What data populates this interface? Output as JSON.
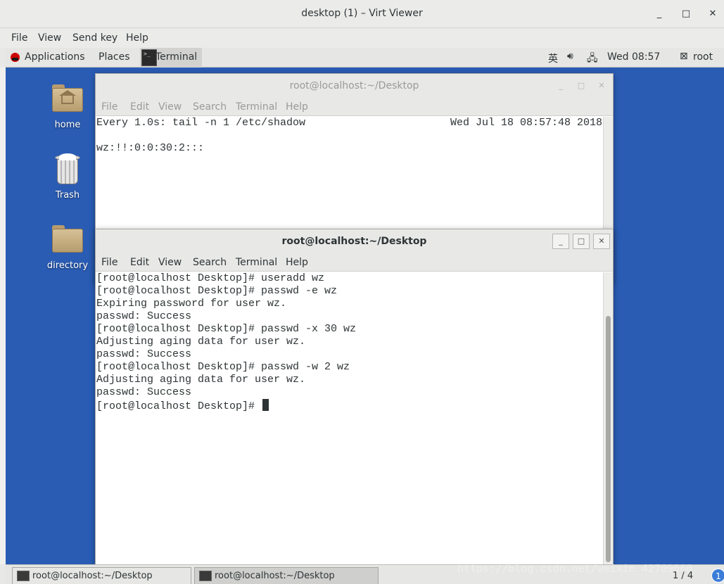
{
  "viewer": {
    "title": "desktop (1) – Virt Viewer",
    "menu": [
      "File",
      "View",
      "Send key",
      "Help"
    ],
    "controls": [
      "_",
      "□",
      "✕"
    ]
  },
  "panel": {
    "applications": "Applications",
    "places": "Places",
    "terminal_tab": "Terminal",
    "ime": "英",
    "clock": "Wed 08:57",
    "user": "root"
  },
  "desktop_icons": [
    {
      "label": "home",
      "icon": "home-folder-icon"
    },
    {
      "label": "Trash",
      "icon": "trash-icon"
    },
    {
      "label": "directory",
      "icon": "folder-icon"
    }
  ],
  "terminal_back": {
    "title": "root@localhost:~/Desktop",
    "menu": [
      "File",
      "Edit",
      "View",
      "Search",
      "Terminal",
      "Help"
    ],
    "header_left": "Every 1.0s: tail -n 1 /etc/shadow",
    "header_right": "Wed Jul 18 08:57:48 2018",
    "lines": [
      "wz:!!:0:0:30:2:::"
    ]
  },
  "terminal_front": {
    "title": "root@localhost:~/Desktop",
    "menu": [
      "File",
      "Edit",
      "View",
      "Search",
      "Terminal",
      "Help"
    ],
    "lines": [
      "[root@localhost Desktop]# useradd wz",
      "[root@localhost Desktop]# passwd -e wz",
      "Expiring password for user wz.",
      "passwd: Success",
      "[root@localhost Desktop]# passwd -x 30 wz",
      "Adjusting aging data for user wz.",
      "passwd: Success",
      "[root@localhost Desktop]# passwd -w 2 wz",
      "Adjusting aging data for user wz.",
      "passwd: Success"
    ],
    "prompt": "[root@localhost Desktop]# "
  },
  "taskbar": {
    "tasks": [
      "root@localhost:~/Desktop",
      "root@localhost:~/Desktop"
    ],
    "pager": "1 / 4",
    "badge": "1"
  },
  "watermark": "https://blog.csdn.net/weixin_42709660",
  "colors": {
    "desktop": "#2a5cb4",
    "panel": "#e6e6e4"
  }
}
